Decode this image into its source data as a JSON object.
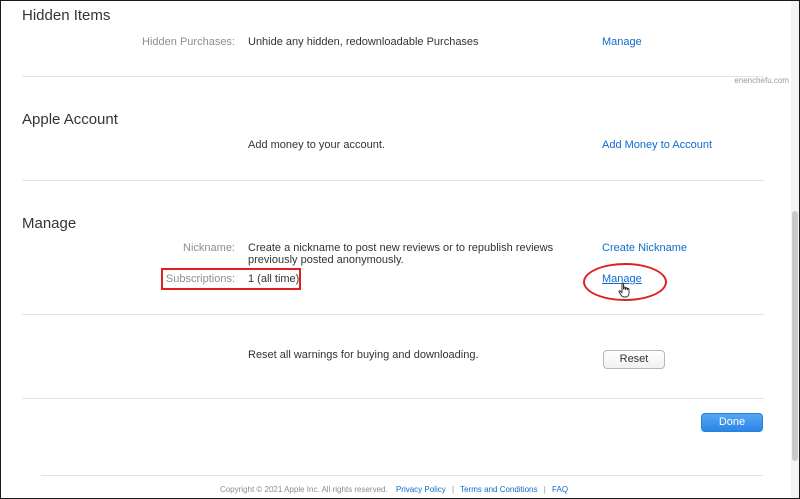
{
  "sections": {
    "hidden_items": {
      "title": "Hidden Items",
      "rows": [
        {
          "label": "Hidden Purchases:",
          "text": "Unhide any hidden, redownloadable Purchases",
          "link": "Manage"
        }
      ]
    },
    "apple_account": {
      "title": "Apple Account",
      "rows": [
        {
          "label": "",
          "text": "Add money to your account.",
          "link": "Add Money to Account"
        }
      ]
    },
    "manage": {
      "title": "Manage",
      "nickname": {
        "label": "Nickname:",
        "text_line1": "Create a nickname to post new reviews or to republish reviews",
        "text_line2": "previously posted anonymously.",
        "link": "Create Nickname"
      },
      "subscriptions": {
        "label": "Subscriptions:",
        "text": "1 (all time)",
        "link": "Manage"
      }
    },
    "reset": {
      "text": "Reset all warnings for buying and downloading.",
      "button": "Reset"
    }
  },
  "done_button": "Done",
  "watermark": "enenchefu.com",
  "footer": {
    "copyright": "Copyright © 2021 Apple Inc. All rights reserved.",
    "privacy": "Privacy Policy",
    "separator": "|",
    "terms": "Terms and Conditions",
    "faq": "FAQ"
  },
  "annotation_colors": {
    "highlight": "#e02020",
    "link": "#0f6ccf",
    "done_button": "#2c86e6"
  }
}
